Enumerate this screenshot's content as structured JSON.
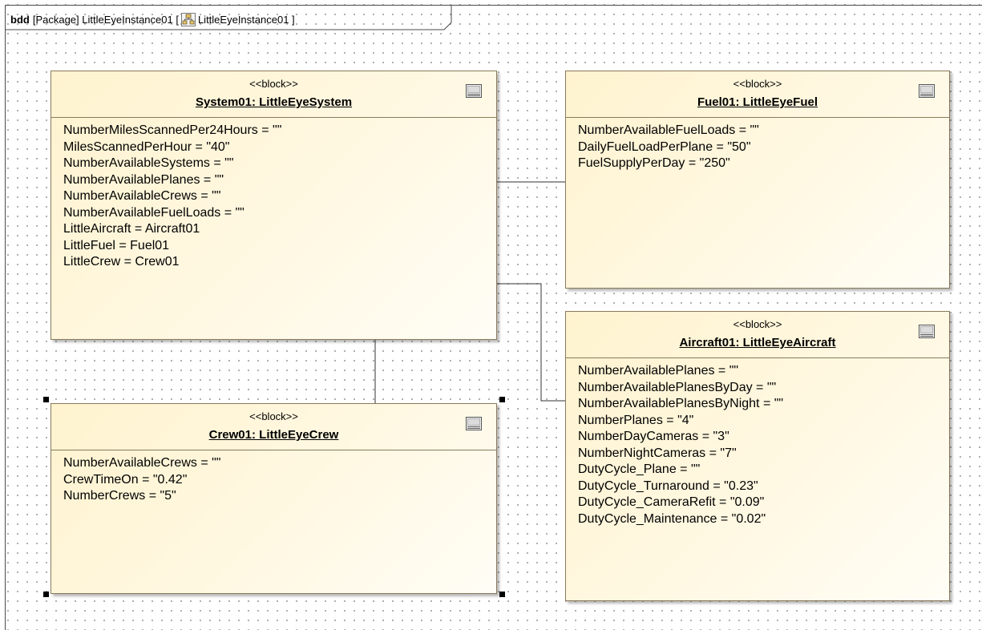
{
  "frame": {
    "keyword": "bdd",
    "package_text": "[Package] LittleEyeInstance01 [",
    "diagram_name": "LittleEyeInstance01 ]",
    "diagram_icon": "block-definition-diagram-icon"
  },
  "blocks": {
    "system": {
      "stereotype": "<<block>>",
      "name": "System01: LittleEyeSystem",
      "icon": "block-compartment-icon",
      "properties": [
        "NumberMilesScannedPer24Hours = \"\"",
        "MilesScannedPerHour = \"40\"",
        "NumberAvailableSystems = \"\"",
        "NumberAvailablePlanes = \"\"",
        "NumberAvailableCrews = \"\"",
        "NumberAvailableFuelLoads = \"\"",
        "LittleAircraft = Aircraft01",
        "LittleFuel = Fuel01",
        "LittleCrew = Crew01"
      ]
    },
    "fuel": {
      "stereotype": "<<block>>",
      "name": "Fuel01: LittleEyeFuel",
      "icon": "block-compartment-icon",
      "properties": [
        "NumberAvailableFuelLoads = \"\"",
        "DailyFuelLoadPerPlane = \"50\"",
        "FuelSupplyPerDay = \"250\""
      ]
    },
    "aircraft": {
      "stereotype": "<<block>>",
      "name": "Aircraft01: LittleEyeAircraft",
      "icon": "block-compartment-icon",
      "properties": [
        "NumberAvailablePlanes = \"\"",
        "NumberAvailablePlanesByDay = \"\"",
        "NumberAvailablePlanesByNight = \"\"",
        "NumberPlanes = \"4\"",
        "NumberDayCameras = \"3\"",
        "NumberNightCameras = \"7\"",
        "DutyCycle_Plane = \"\"",
        "DutyCycle_Turnaround = \"0.23\"",
        "DutyCycle_CameraRefit = \"0.09\"",
        "DutyCycle_Maintenance = \"0.02\""
      ]
    },
    "crew": {
      "stereotype": "<<block>>",
      "name": "Crew01: LittleEyeCrew",
      "icon": "block-compartment-icon",
      "properties": [
        "NumberAvailableCrews = \"\"",
        "CrewTimeOn = \"0.42\"",
        "NumberCrews = \"5\""
      ]
    }
  },
  "colors": {
    "block_fill_start": "#fff3cf",
    "block_fill_end": "#fffdf6",
    "block_border": "#8a7a5a",
    "connector": "#333333"
  }
}
